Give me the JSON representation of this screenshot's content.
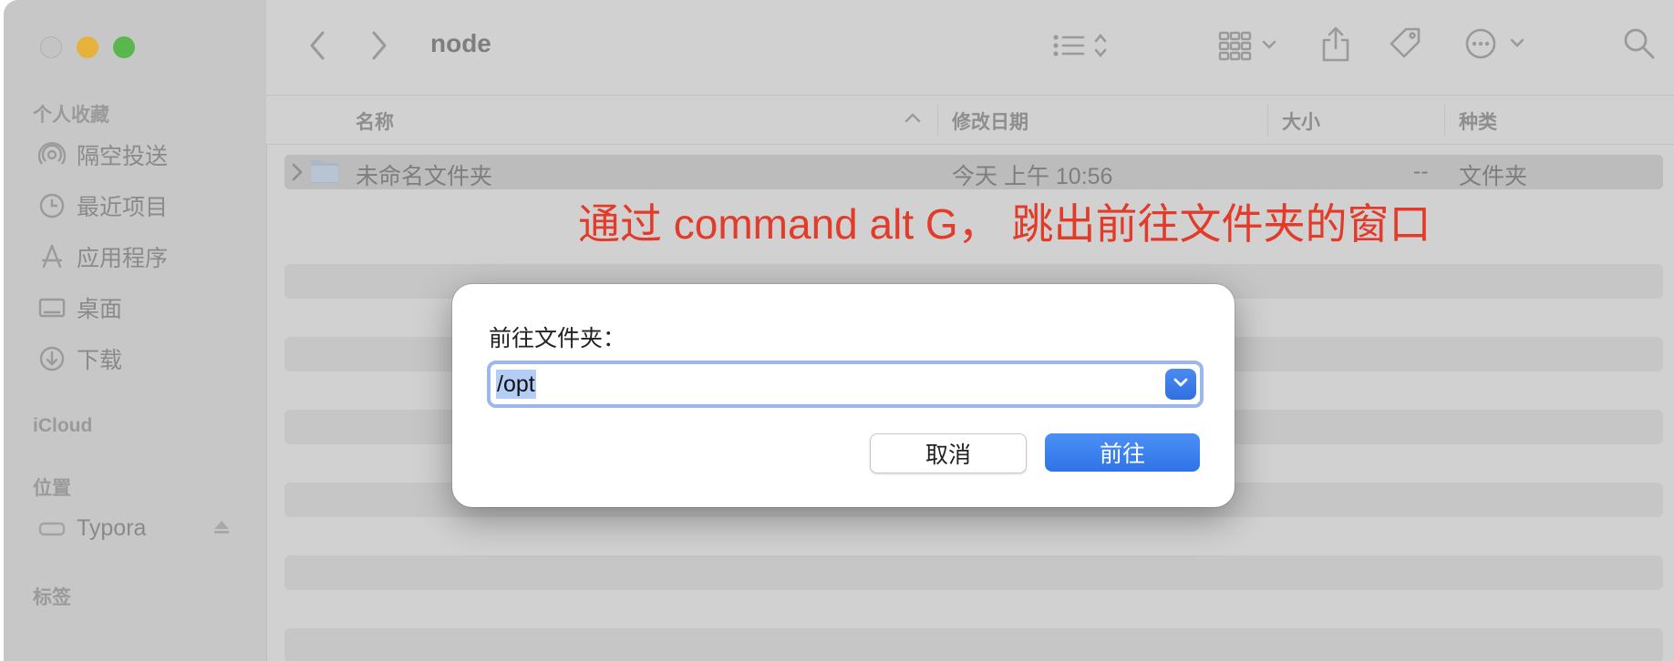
{
  "toolbar": {
    "title": "node"
  },
  "sidebar": {
    "favorites_title": "个人收藏",
    "favorites": [
      {
        "label": "隔空投送",
        "icon": "airdrop-icon"
      },
      {
        "label": "最近项目",
        "icon": "clock-icon"
      },
      {
        "label": "应用程序",
        "icon": "applications-icon"
      },
      {
        "label": "桌面",
        "icon": "desktop-icon"
      },
      {
        "label": "下载",
        "icon": "download-icon"
      }
    ],
    "icloud_title": "iCloud",
    "locations_title": "位置",
    "locations": [
      {
        "label": "Typora",
        "icon": "drive-icon"
      }
    ],
    "tags_title": "标签"
  },
  "columns": {
    "name": "名称",
    "date": "修改日期",
    "size": "大小",
    "kind": "种类"
  },
  "rows": [
    {
      "name": "未命名文件夹",
      "date": "今天 上午 10:56",
      "size": "--",
      "kind": "文件夹"
    }
  ],
  "annotation": "通过 command alt G， 跳出前往文件夹的窗口",
  "dialog": {
    "label": "前往文件夹：",
    "path_value": "/opt",
    "cancel_label": "取消",
    "go_label": "前往"
  },
  "colors": {
    "accent": "#2f73e8",
    "annotation": "#e23b2a"
  }
}
